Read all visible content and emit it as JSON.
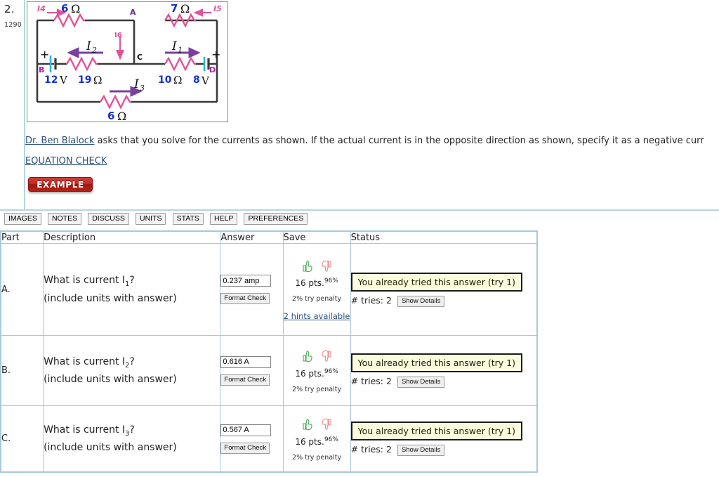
{
  "problem": {
    "number": "2.",
    "id": "1290",
    "prompt_link": "Dr. Ben Blalock",
    "prompt_text": " asks that you solve for the currents as shown. If the actual current is in the opposite direction as shown, specify it as a negative curr",
    "equation_check_label": "EQUATION CHECK",
    "example_label": "EXAMPLE"
  },
  "figure": {
    "name": "circuit-diagram",
    "border_color": "#6f9e53",
    "labels": {
      "i4": "I4",
      "i5": "I5",
      "i6": "I6",
      "i1": "I",
      "i1_sub": "1",
      "i2": "I",
      "i2_sub": "2",
      "i3": "I",
      "i3_sub": "3",
      "node_a": "A",
      "node_b": "B",
      "node_c": "C",
      "node_d": "D",
      "r_top_left_value": "6",
      "r_top_left_unit": "Ω",
      "r_top_right_value": "7",
      "r_top_right_unit": "Ω",
      "r_mid_left_value": "19",
      "r_mid_left_unit": "Ω",
      "r_mid_right_value": "10",
      "r_mid_right_unit": "Ω",
      "r_bottom_value": "6",
      "r_bottom_unit": "Ω",
      "v_left_value": "12",
      "v_left_unit": "V",
      "v_right_value": "8",
      "v_right_unit": "V",
      "plus_left": "+",
      "plus_right": "+"
    },
    "colors": {
      "resistor": "#e2529a",
      "value_text": "#1432d2",
      "current_arrow": "#7b3fa0",
      "node_label": "#b11ab1",
      "battery": "#2fb6e8",
      "wire": "#3a3a3a"
    }
  },
  "toolbar": {
    "buttons": [
      {
        "label": "IMAGES",
        "name": "toolbar-images"
      },
      {
        "label": "NOTES",
        "name": "toolbar-notes"
      },
      {
        "label": "DISCUSS",
        "name": "toolbar-discuss"
      },
      {
        "label": "UNITS",
        "name": "toolbar-units"
      },
      {
        "label": "STATS",
        "name": "toolbar-stats"
      },
      {
        "label": "HELP",
        "name": "toolbar-help"
      },
      {
        "label": "PREFERENCES",
        "name": "toolbar-preferences"
      }
    ]
  },
  "table": {
    "headers": {
      "part": "Part",
      "description": "Description",
      "answer": "Answer",
      "save": "Save",
      "status": "Status"
    },
    "rows": [
      {
        "part": "A.",
        "question_prefix": "What is current I",
        "question_sub": "1",
        "question_suffix": "?",
        "question_note": "(include units with answer)",
        "answer_value": "0.237 amp",
        "format_check_label": "Format Check",
        "points": "16 pts.",
        "percent": "96%",
        "penalty": "2% try penalty",
        "hints": "2 hints available",
        "status_message": "You already tried this answer (try 1)",
        "tries_label": "# tries: 2",
        "details_label": "Show Details"
      },
      {
        "part": "B.",
        "question_prefix": "What is current I",
        "question_sub": "2",
        "question_suffix": "?",
        "question_note": "(include units with answer)",
        "answer_value": "0.616 A",
        "format_check_label": "Format Check",
        "points": "16 pts.",
        "percent": "96%",
        "penalty": "2% try penalty",
        "hints": "",
        "status_message": "You already tried this answer (try 1)",
        "tries_label": "# tries: 2",
        "details_label": "Show Details"
      },
      {
        "part": "C.",
        "question_prefix": "What is current I",
        "question_sub": "3",
        "question_suffix": "?",
        "question_note": "(include units with answer)",
        "answer_value": "0.567 A",
        "format_check_label": "Format Check",
        "points": "16 pts.",
        "percent": "96%",
        "penalty": "2% try penalty",
        "hints": "",
        "status_message": "You already tried this answer (try 1)",
        "tries_label": "# tries: 2",
        "details_label": "Show Details"
      }
    ]
  }
}
